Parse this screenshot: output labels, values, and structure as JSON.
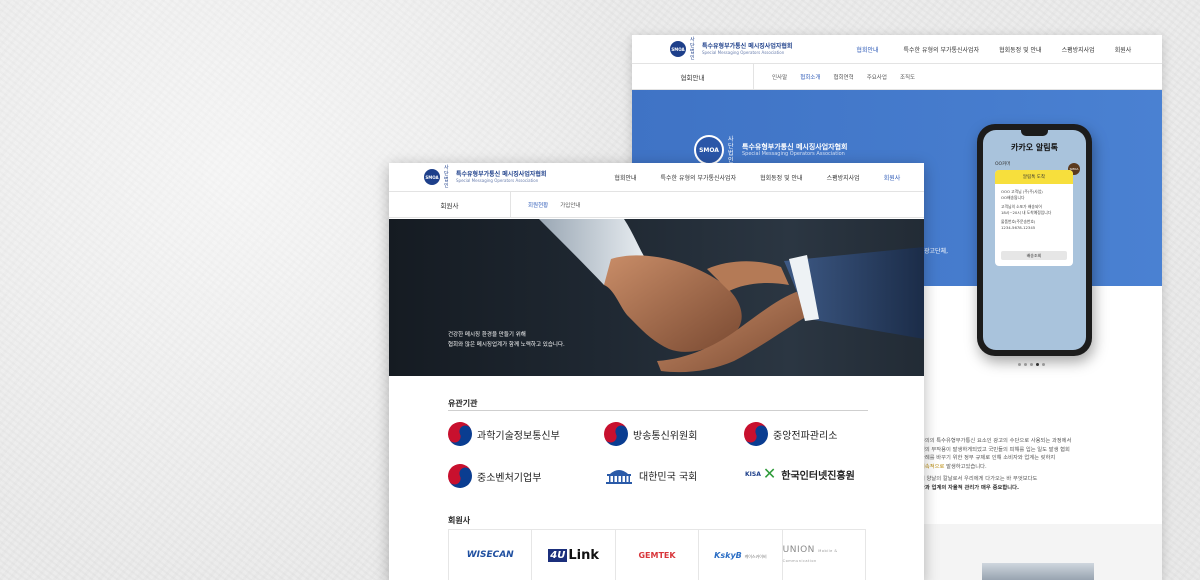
{
  "colors": {
    "brand_navy": "#1d3f8a",
    "active_blue": "#2e5bb8",
    "hero_blue": "#4a81d2",
    "kakao_yellow": "#f7df3c",
    "gov_red": "#c8102e",
    "gov_blue": "#0a3d91"
  },
  "back_page": {
    "logo": {
      "badge": "SMOA",
      "prefix": "사단 법인",
      "name": "특수유형부가통신 메시징사업자협회",
      "english": "Special Messaging Operators Association"
    },
    "nav": [
      "협회안내",
      "특수한 유형의 부가통신사업자",
      "협회동정 및 안내",
      "스팸방지사업",
      "회원사"
    ],
    "nav_active": "협회안내",
    "section_title": "협회안내",
    "sub_menu": [
      "인사말",
      "협회소개",
      "협회연혁",
      "주요사업",
      "조직도"
    ],
    "sub_active": "협회소개",
    "hero_clip_text": "광고단체,",
    "phone": {
      "title": "카카오 알림톡",
      "sender": "OO커머",
      "card_header": "알림톡 도착",
      "lines": [
        "OOO 고객님 (주)주(사업)",
        "OO배송됩니다",
        "고객님의 소포가 배송되어",
        "18시~20시 내 도착예정입니다",
        "물품번호(주문송번호)",
        "1234-5678-12345"
      ],
      "button": "배송조회",
      "avatar": "SMOA"
    },
    "body_text": {
      "line1": "주의의 특수유형부가통신 요소인 광고의 수단으로 사용되는 과정에서",
      "line2": "인의 부작용이 발생하게되었고 국민들의 피해를 입는 일도 발생 협회",
      "line3": "사례를 바꾸기 위한 정부 규제로 인해 소비자와 업계는 릿하지",
      "highlight": "지속적으로",
      "line4_end": "발생하고있습니다.",
      "line5": "의 양날의 칼날로서 우리에게 다가오는 바 무엇보다도",
      "line6": "확과 업계의 자율적 관리가 매우 중요합니다."
    }
  },
  "front_page": {
    "logo": {
      "badge": "SMOA",
      "prefix": "사단 법인",
      "name": "특수유형부가통신 메시징사업자협회",
      "english": "Special Messaging Operators Association"
    },
    "nav": [
      "협회안내",
      "특수한 유형의 부가통신사업자",
      "협회동정 및 안내",
      "스팸방지사업",
      "회원사"
    ],
    "nav_active": "회원사",
    "section_title": "회원사",
    "sub_menu": [
      "회원현황",
      "가입안내"
    ],
    "sub_active": "회원현황",
    "hero_copy": {
      "line1": "건강한 메시징 환경을 만들기 위해",
      "line2": "협회와 많은 메시징업계가 함께 노력하고 있습니다."
    },
    "related_title": "유관기관",
    "related_orgs": [
      {
        "name": "과학기술정보통신부",
        "icon": "taegeuk-icon"
      },
      {
        "name": "방송통신위원회",
        "icon": "taegeuk-icon"
      },
      {
        "name": "중앙전파관리소",
        "icon": "taegeuk-icon"
      },
      {
        "name": "중소벤처기업부",
        "icon": "taegeuk-icon"
      },
      {
        "name": "대한민국 국회",
        "icon": "national-assembly-icon"
      },
      {
        "name": "한국인터넷진흥원",
        "icon": "kisa-icon",
        "prefix": "KISA"
      }
    ],
    "members_title": "회원사",
    "members": [
      {
        "name": "WISECAN"
      },
      {
        "name": "4U Link",
        "box": "4U",
        "text": "Link"
      },
      {
        "name": "GEMTEK"
      },
      {
        "name": "KskyB",
        "sub": "케이스카이비"
      },
      {
        "name": "UNION",
        "sub": "Mobile & Communication"
      }
    ]
  }
}
